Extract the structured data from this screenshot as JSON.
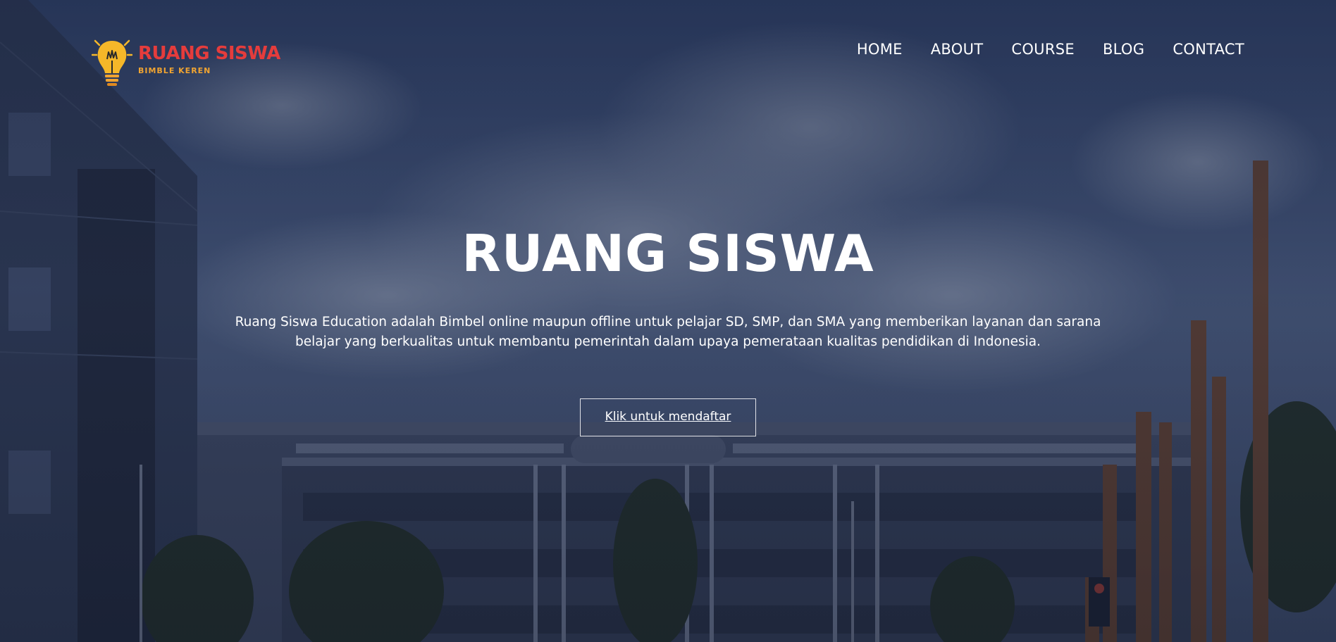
{
  "brand": {
    "name": "RUANG SISWA",
    "tagline": "BIMBLE KEREN"
  },
  "nav": {
    "items": [
      {
        "label": "HOME"
      },
      {
        "label": "ABOUT"
      },
      {
        "label": "COURSE"
      },
      {
        "label": "BLOG"
      },
      {
        "label": "CONTACT"
      }
    ]
  },
  "hero": {
    "title": "RUANG SISWA",
    "description": "Ruang Siswa Education adalah Bimbel online maupun offline untuk pelajar SD, SMP, dan SMA yang memberikan layanan dan sarana belajar yang berkualitas untuk membantu pemerintah dalam upaya pemerataan kualitas pendidikan di Indonesia.",
    "cta_label": "Klik untuk mendaftar"
  },
  "colors": {
    "brand_red": "#e53c3c",
    "brand_orange": "#f0a431",
    "bulb_yellow": "#f5b729"
  },
  "icons": {
    "logo": "lightbulb-icon"
  }
}
